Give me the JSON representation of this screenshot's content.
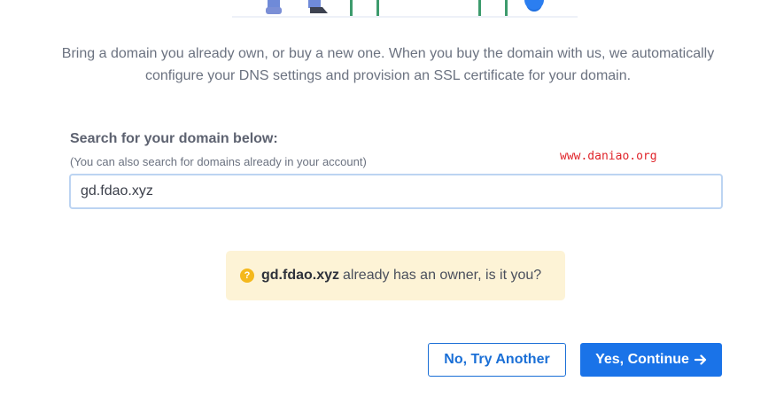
{
  "intro_text": "Bring a domain you already own, or buy a new one. When you buy the domain with us, we automatically configure your DNS settings and provision an SSL certificate for your domain.",
  "search": {
    "label": "Search for your domain below:",
    "hint": "(You can also search for domains already in your account)",
    "value": "gd.fdao.xyz"
  },
  "watermark": "www.daniao.org",
  "notice": {
    "icon": "question-circle-icon",
    "domain": "gd.fdao.xyz",
    "message": "already has an owner, is it you?",
    "color": "#fdf3d6"
  },
  "buttons": {
    "secondary_label": "No, Try Another",
    "primary_label": "Yes, Continue",
    "primary_icon": "arrow-right-icon",
    "accent": "#1a73e8"
  }
}
